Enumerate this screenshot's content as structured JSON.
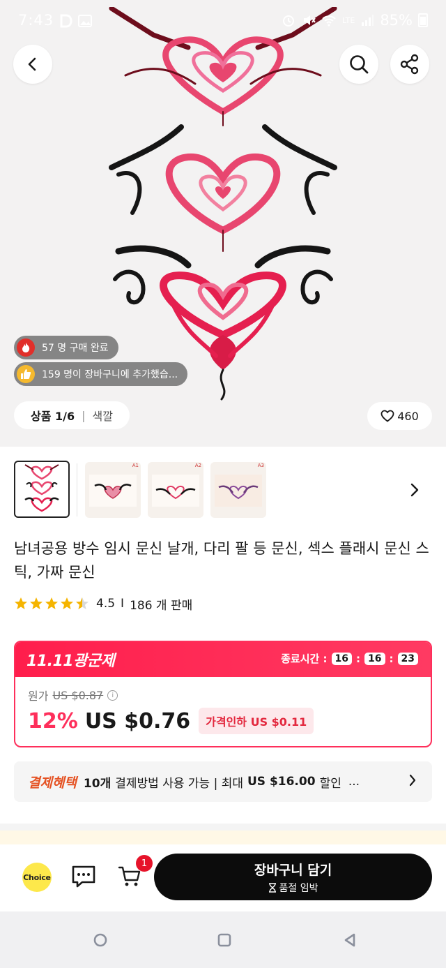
{
  "status_bar": {
    "time": "7:43",
    "battery": "85%",
    "left_icons": [
      "d-app-icon",
      "image-icon"
    ],
    "right_icons": [
      "alarm-icon",
      "mute-icon",
      "wifi-icon",
      "lte-signal-icon"
    ],
    "network_label": "LTE"
  },
  "hero": {
    "social_proof": [
      {
        "icon": "fire-icon",
        "text": "57 명 구매 완료"
      },
      {
        "icon": "thumbs-up-icon",
        "text": "159 명이 장바구니에 추가했습..."
      }
    ],
    "image_counter": "상품 1/6",
    "image_counter_sub": "색깔",
    "wishlist_count": "460"
  },
  "thumbnails": [
    {
      "tag": ""
    },
    {
      "tag": "A1"
    },
    {
      "tag": "A2"
    },
    {
      "tag": "A3"
    }
  ],
  "product": {
    "title": "남녀공용 방수 임시 문신 날개, 다리 팔 등 문신, 섹스 플래시 문신 스틱, 가짜 문신",
    "rating": "4.5",
    "stars": 4.5,
    "sold": "186 개 판매"
  },
  "promo": {
    "event_name": "11.11광군제",
    "timer_label": "종료시간 :",
    "timer": [
      "16",
      "16",
      "23"
    ],
    "original_label": "원가",
    "original_price": "US $0.87",
    "discount_percent": "12%",
    "price": "US $0.76",
    "price_cut": "가격인하 US $0.11"
  },
  "payment_benefit": {
    "label": "결제혜택",
    "count": "10개",
    "text": "결제방법 사용 가능 | 최대",
    "amount": "US $16.00",
    "suffix": "할인",
    "ellipsis": "..."
  },
  "action_bar": {
    "choice_label": "Choice",
    "cart_count": "1",
    "add_to_cart": "장바구니 담기",
    "add_to_cart_sub": "품절 임박"
  },
  "colors": {
    "accent": "#fe2f5b",
    "choice_yellow": "#fde84b",
    "benefit_orange": "#e55223",
    "dark_button": "#0c0c0c"
  }
}
